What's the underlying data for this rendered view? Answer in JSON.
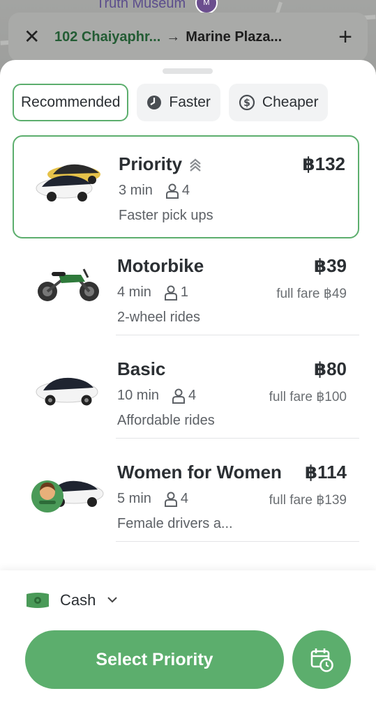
{
  "map": {
    "place_label": "Truth Museum",
    "pin_label": "M"
  },
  "route": {
    "from": "102 Chaiyaphr...",
    "arrow": "→",
    "to": "Marine Plaza...",
    "close_icon": "close-icon",
    "add_icon": "plus-icon"
  },
  "filters": [
    {
      "label": "Recommended",
      "active": true
    },
    {
      "label": "Faster",
      "icon": "clock-icon",
      "active": false
    },
    {
      "label": "Cheaper",
      "icon": "dollar-icon",
      "active": false
    }
  ],
  "rides": [
    {
      "name": "Priority",
      "price": "฿132",
      "eta": "3 min",
      "seats": "4",
      "full_fare": "",
      "desc": "Faster pick ups",
      "selected": true
    },
    {
      "name": "Motorbike",
      "price": "฿39",
      "eta": "4 min",
      "seats": "1",
      "full_fare": "full fare ฿49",
      "desc": "2-wheel rides",
      "selected": false
    },
    {
      "name": "Basic",
      "price": "฿80",
      "eta": "10 min",
      "seats": "4",
      "full_fare": "full fare ฿100",
      "desc": "Affordable rides",
      "selected": false
    },
    {
      "name": "Women for Women",
      "price": "฿114",
      "eta": "5 min",
      "seats": "4",
      "full_fare": "full fare ฿139",
      "desc": "Female drivers a...",
      "selected": false
    }
  ],
  "payment": {
    "method": "Cash",
    "icon": "cash-icon"
  },
  "actions": {
    "select_label": "Select Priority",
    "schedule_icon": "calendar-clock-icon"
  },
  "colors": {
    "accent": "#5cae6d",
    "text": "#2b2f33",
    "muted": "#5d6166"
  }
}
